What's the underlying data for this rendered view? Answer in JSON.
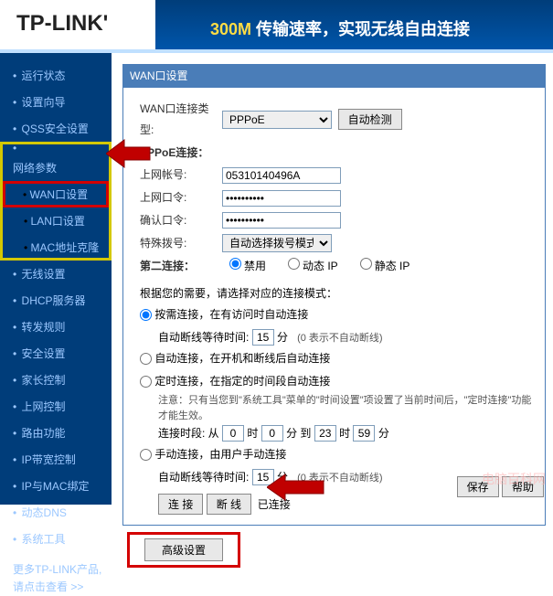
{
  "header": {
    "logo": "TP-LINK'",
    "banner_speed": "300M",
    "banner_text": " 传输速率，实现无线自由连接"
  },
  "sidebar": {
    "items": [
      "运行状态",
      "设置向导",
      "QSS安全设置",
      "网络参数",
      "WAN口设置",
      "LAN口设置",
      "MAC地址克隆",
      "无线设置",
      "DHCP服务器",
      "转发规则",
      "安全设置",
      "家长控制",
      "上网控制",
      "路由功能",
      "IP带宽控制",
      "IP与MAC绑定",
      "动态DNS",
      "系统工具"
    ],
    "more1": "更多TP-LINK产品,",
    "more2": "请点击查看 >>"
  },
  "panel": {
    "title": "WAN口设置",
    "wan_type_label": "WAN口连接类型:",
    "wan_type_value": "PPPoE",
    "auto_detect": "自动检测",
    "pppoe_label": "PPPoE连接：",
    "user_label": "上网帐号:",
    "user_value": "05310140496A",
    "pass_label": "上网口令:",
    "pass_value": "••••••••••",
    "confirm_label": "确认口令:",
    "confirm_value": "••••••••••",
    "special_label": "特殊拨号:",
    "special_value": "自动选择拨号模式",
    "second_label": "第二连接：",
    "second_opts": [
      "禁用",
      "动态 IP",
      "静态 IP"
    ],
    "need_label": "根据您的需要，请选择对应的连接模式：",
    "mode1": "按需连接，在有访问时自动连接",
    "idle_label": "自动断线等待时间:",
    "idle_value": "15",
    "idle_unit": "分",
    "idle_note": "(0 表示不自动断线)",
    "mode2": "自动连接，在开机和断线后自动连接",
    "mode3": "定时连接，在指定的时间段自动连接",
    "mode3_note": "注意：只有当您到\"系统工具\"菜单的\"时间设置\"项设置了当前时间后，\"定时连接\"功能才能生效。",
    "time_label": "连接时段: 从",
    "t1": "0",
    "t2": "0",
    "t3": "23",
    "t4": "59",
    "hour": "时",
    "min": "分",
    "to": "到",
    "mode4": "手动连接，由用户手动连接",
    "idle2_value": "15",
    "connect_btn": "连 接",
    "disconnect_btn": "断 线",
    "status": "已连接",
    "advanced": "高级设置",
    "save": "保存",
    "help": "帮助"
  },
  "watermark": "电脑百科网"
}
